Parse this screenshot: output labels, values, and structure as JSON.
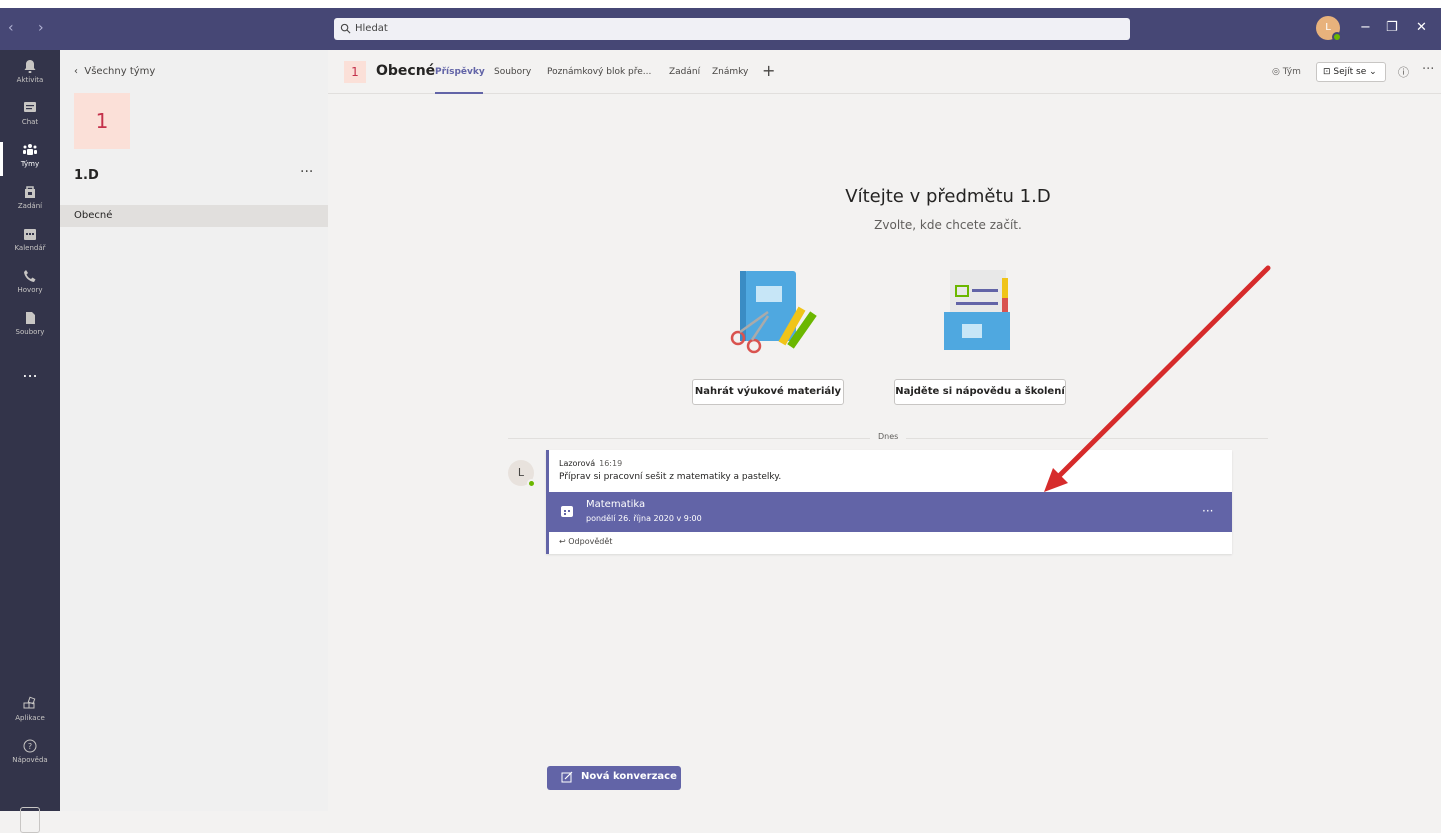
{
  "search": {
    "placeholder": "Hledat"
  },
  "user_avatar": {
    "initial": "L"
  },
  "rail": {
    "items": [
      {
        "label": "Aktivita",
        "icon": "bell-icon"
      },
      {
        "label": "Chat",
        "icon": "chat-icon"
      },
      {
        "label": "Týmy",
        "icon": "teams-icon",
        "active": true
      },
      {
        "label": "Zadání",
        "icon": "assignments-icon"
      },
      {
        "label": "Kalendář",
        "icon": "calendar-icon"
      },
      {
        "label": "Hovory",
        "icon": "phone-icon"
      },
      {
        "label": "Soubory",
        "icon": "file-icon"
      }
    ],
    "more": "...",
    "apps_label": "Aplikace",
    "help_label": "Nápověda"
  },
  "teams_pane": {
    "back_label": "Všechny týmy",
    "tile": "1",
    "team_name": "1.D",
    "more": "···",
    "channel": "Obecné"
  },
  "channel_header": {
    "badge": "1",
    "name": "Obecné",
    "tabs": [
      "Příspěvky",
      "Soubory",
      "Poznámkový blok pře...",
      "Zadání",
      "Známky"
    ],
    "tym": "Tým",
    "sejit": "Sejít se"
  },
  "welcome": {
    "title": "Vítejte v předmětu 1.D",
    "subtitle": "Zvolte, kde chcete začít.",
    "btn_upload": "Nahrát výukové materiály",
    "btn_help": "Najděte si nápovědu a školení"
  },
  "feed": {
    "day_label": "Dnes",
    "avatar": "L",
    "author": "Lazorová",
    "time": "16:19",
    "text": "Příprav si pracovní sešit z matematiky a pastelky.",
    "meeting_title": "Matematika",
    "meeting_date": "pondělí 26. října 2020 v 9:00",
    "meeting_more": "···",
    "reply": "Odpovědět"
  },
  "new_conversation": "Nová konverzace",
  "colors": {
    "accent": "#6264a7",
    "titlebar": "#464775",
    "rail": "#33344a",
    "arrow": "#d62b2b"
  }
}
